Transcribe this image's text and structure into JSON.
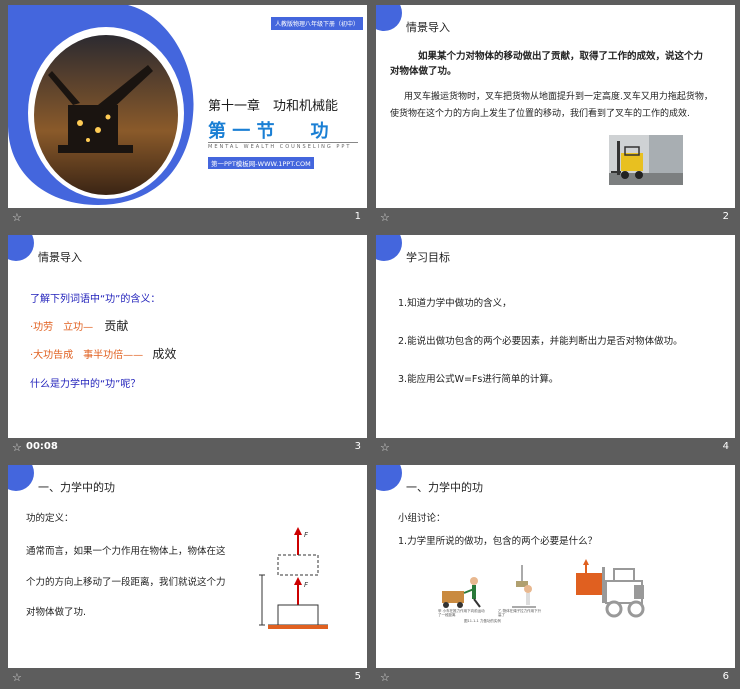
{
  "slides": [
    {
      "num": "1",
      "ribbon": "人教版物理八年级下册（初中）",
      "chapter": "第十一章　功和机械能",
      "section": "第 一 节　　功",
      "subtitle": "MENTAL  WEALTH  COUNSELING  PPT",
      "site": "第一PPT模板网-WWW.1PPT.COM"
    },
    {
      "num": "2",
      "heading": "情景导入",
      "para1": "如果某个力对物体的移动做出了贡献，取得了工作的成效，说这个力对物体做了功。",
      "para2": "用叉车搬运货物时，叉车把货物从地面提升到一定高度.叉车又用力拖起货物，使货物在这个力的方向上发生了位置的移动，我们看到了叉车的工作的成效."
    },
    {
      "num": "3",
      "time": "00:08",
      "heading": "情景导入",
      "intro": "了解下列词语中“功”的含义：",
      "item1": "·功劳　立功—",
      "item1_tail": "贡献",
      "item2": "·大功告成　事半功倍——",
      "item2_tail": "成效",
      "question": "什么是力学中的“功”呢？"
    },
    {
      "num": "4",
      "heading": "学习目标",
      "goal1": "1.知道力学中做功的含义，",
      "goal2": "2.能说出做功包含的两个必要因素，并能判断出力是否对物体做功。",
      "goal3": "3.能应用公式W=Fs进行简单的计算。"
    },
    {
      "num": "5",
      "heading": "一、力学中的功",
      "def_label": "功的定义：",
      "def_line1": "通常而言，如果一个力作用在物体上，物体在这",
      "def_line2": "个力的方向上移动了一段距离，我们就说这个力",
      "def_line3": "对物体做了功."
    },
    {
      "num": "6",
      "heading": "一、力学中的功",
      "discuss": "小组讨论：",
      "question": "1.力学里所说的做功，包含的两个必要是什么？",
      "caption1": "甲 小车在推力作用下向前运动了一段距离",
      "caption2": "乙 物体在绳子拉力作用下升高了",
      "caption3": "图11.1-1 力做功的实例"
    }
  ],
  "colors": {
    "accent": "#4466dd",
    "title": "#1a7fd4",
    "orange": "#e06020",
    "blue_text": "#2222bb",
    "bg": "#5d5d5d"
  }
}
